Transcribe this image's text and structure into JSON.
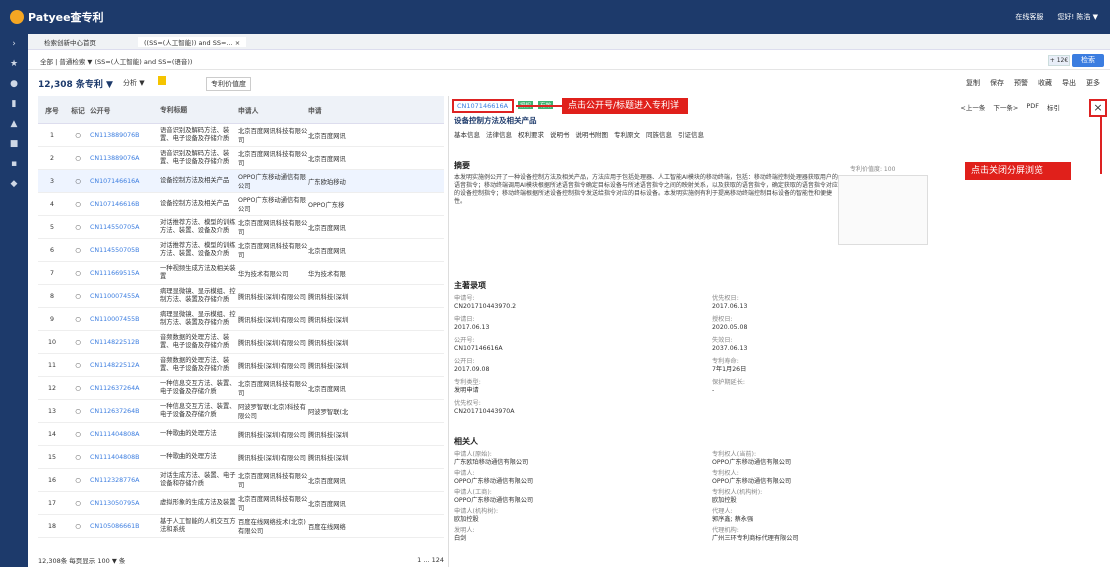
{
  "app": {
    "name": "Patyee查专利",
    "top_links": [
      "在线客服",
      "您好! 陈浩 ▼"
    ]
  },
  "tabs": [
    {
      "label": "检索创新中心首页"
    },
    {
      "label": "((SS=(人工智能)) and SS=... ×"
    }
  ],
  "search": {
    "scope": "全部",
    "mode": "普通检索 ▼",
    "query": "(SS=(人工智能) and SS=(语音))",
    "zoom": "+ 12€",
    "button": "检索"
  },
  "toolbar": {
    "count": "12,308 条专利 ▼",
    "analyze": "分析 ▼",
    "sort": "专利价值度",
    "actions": [
      "复制",
      "保存",
      "预警",
      "收藏",
      "导出",
      "更多"
    ]
  },
  "table": {
    "headers": [
      "序号",
      "标记",
      "公开号",
      "专利标题",
      "申请人",
      "申请"
    ],
    "rows": [
      [
        "1",
        "○",
        "CN113889076B",
        "语音识别及解码方法、装置、电子设备及存储介质",
        "北京百度网讯科技有限公司",
        "北京百度网讯"
      ],
      [
        "2",
        "○",
        "CN113889076A",
        "语音识别及解码方法、装置、电子设备及存储介质",
        "北京百度网讯科技有限公司",
        "北京百度网讯"
      ],
      [
        "3",
        "○",
        "CN107146616A",
        "设备控制方法及相关产品",
        "OPPO广东移动通信有限公司",
        "广东欧珀移动"
      ],
      [
        "4",
        "○",
        "CN107146616B",
        "设备控制方法及相关产品",
        "OPPO广东移动通信有限公司",
        "OPPO广东移"
      ],
      [
        "5",
        "○",
        "CN114550705A",
        "对话推荐方法、模型的训练方法、装置、设备及介质",
        "北京百度网讯科技有限公司",
        "北京百度网讯"
      ],
      [
        "6",
        "○",
        "CN114550705B",
        "对话推荐方法、模型的训练方法、装置、设备及介质",
        "北京百度网讯科技有限公司",
        "北京百度网讯"
      ],
      [
        "7",
        "○",
        "CN111669515A",
        "一种视频生成方法及相关装置",
        "华为技术有限公司",
        "华为技术有限"
      ],
      [
        "8",
        "○",
        "CN110007455A",
        "病理显微镜、显示模组、控制方法、装置及存储介质",
        "腾讯科技(深圳)有限公司",
        "腾讯科技(深圳"
      ],
      [
        "9",
        "○",
        "CN110007455B",
        "病理显微镜、显示模组、控制方法、装置及存储介质",
        "腾讯科技(深圳)有限公司",
        "腾讯科技(深圳"
      ],
      [
        "10",
        "○",
        "CN114822512B",
        "音频数据的处理方法、装置、电子设备及存储介质",
        "腾讯科技(深圳)有限公司",
        "腾讯科技(深圳"
      ],
      [
        "11",
        "○",
        "CN114822512A",
        "音频数据的处理方法、装置、电子设备及存储介质",
        "腾讯科技(深圳)有限公司",
        "腾讯科技(深圳"
      ],
      [
        "12",
        "○",
        "CN112637264A",
        "一种信息交互方法、装置、电子设备及存储介质",
        "北京百度网讯科技有限公司",
        "北京百度网讯"
      ],
      [
        "13",
        "○",
        "CN112637264B",
        "一种信息交互方法、装置、电子设备及存储介质",
        "阿波罗智联(北京)科技有限公司",
        "阿波罗智联(北"
      ],
      [
        "14",
        "○",
        "CN111404808A",
        "一种歌曲的处理方法",
        "腾讯科技(深圳)有限公司",
        "腾讯科技(深圳"
      ],
      [
        "15",
        "○",
        "CN111404808B",
        "一种歌曲的处理方法",
        "腾讯科技(深圳)有限公司",
        "腾讯科技(深圳"
      ],
      [
        "16",
        "○",
        "CN112328776A",
        "对话生成方法、装置、电子设备和存储介质",
        "北京百度网讯科技有限公司",
        "北京百度网讯"
      ],
      [
        "17",
        "○",
        "CN113050795A",
        "虚拟形象的生成方法及装置",
        "北京百度网讯科技有限公司",
        "北京百度网讯"
      ],
      [
        "18",
        "○",
        "CN105086661B",
        "基于人工智能的人机交互方法和系统",
        "百度在线网络技术(北京)有限公司",
        "百度在线网络"
      ]
    ]
  },
  "footer": {
    "text": "12,308条 每页显示 100 ▼ 条",
    "pages": "1 ... 124"
  },
  "detail": {
    "patent_no": "CN107146616A",
    "tags": [
      "授权",
      "有效"
    ],
    "annotation_top": "点击公开号/标题进入专利详情页",
    "annotation_close": "点击关闭分屏浏览",
    "nav": [
      "<上一条",
      "下一条>",
      "PDF",
      "标引"
    ],
    "title": "设备控制方法及相关产品",
    "subtabs": [
      "基本信息",
      "法律信息",
      "权利要求",
      "说明书",
      "说明书附图",
      "专利原文",
      "同族信息",
      "引证信息"
    ],
    "abstract_heading": "摘要",
    "value_label": "专利价值度: 100",
    "abstract": "本发明实施例公开了一种设备控制方法及相关产品，方法应用于包括处理器、人工智能AI模块的移动终端，包括：移动终端控制处理器获取用户的语音指令；移动终端调用AI模块根据所述语音指令确定目标设备与所述语音指令之间的映射关系，以及获取的语音指令，确定获取的语音指令对应的设备控制指令；移动终端根据所述设备控制指令发送给指令对应的目标设备。本发明实施例有利于提高移动终端控制目标设备的智能性和便捷性。",
    "main_heading": "主著录项",
    "related_heading": "相关人",
    "fields_left": [
      {
        "k": "申请号:",
        "v": "CN201710443970.2"
      },
      {
        "k": "申请日:",
        "v": "2017.06.13"
      },
      {
        "k": "公开号:",
        "v": "CN107146616A"
      },
      {
        "k": "公开日:",
        "v": "2017.09.08"
      },
      {
        "k": "专利类型:",
        "v": "发明申请"
      },
      {
        "k": "优先权号:",
        "v": "CN201710443970A"
      }
    ],
    "fields_right": [
      {
        "k": "优先权日:",
        "v": "2017.06.13"
      },
      {
        "k": "授权日:",
        "v": "2020.05.08"
      },
      {
        "k": "失效日:",
        "v": "2037.06.13"
      },
      {
        "k": "专利寿命:",
        "v": "7年1月26日"
      },
      {
        "k": "保护期延长:",
        "v": "-"
      }
    ],
    "people_left": [
      {
        "k": "申请人(原始):",
        "v": "广东欧珀移动通信有限公司"
      },
      {
        "k": "申请人:",
        "v": "OPPO广东移动通信有限公司"
      },
      {
        "k": "申请人(工商):",
        "v": "OPPO广东移动通信有限公司"
      },
      {
        "k": "申请人(机构树):",
        "v": "欧加控股"
      },
      {
        "k": "发明人:",
        "v": "白剑"
      }
    ],
    "people_right": [
      {
        "k": "专利权人(当前):",
        "v": "OPPO广东移动通信有限公司"
      },
      {
        "k": "专利权人:",
        "v": "OPPO广东移动通信有限公司"
      },
      {
        "k": "专利权人(机构树):",
        "v": "欧加控股"
      },
      {
        "k": "代理人:",
        "v": "郭序鑫; 蔡永强"
      },
      {
        "k": "代理机构:",
        "v": "广州三环专利商标代理有限公司"
      }
    ]
  }
}
